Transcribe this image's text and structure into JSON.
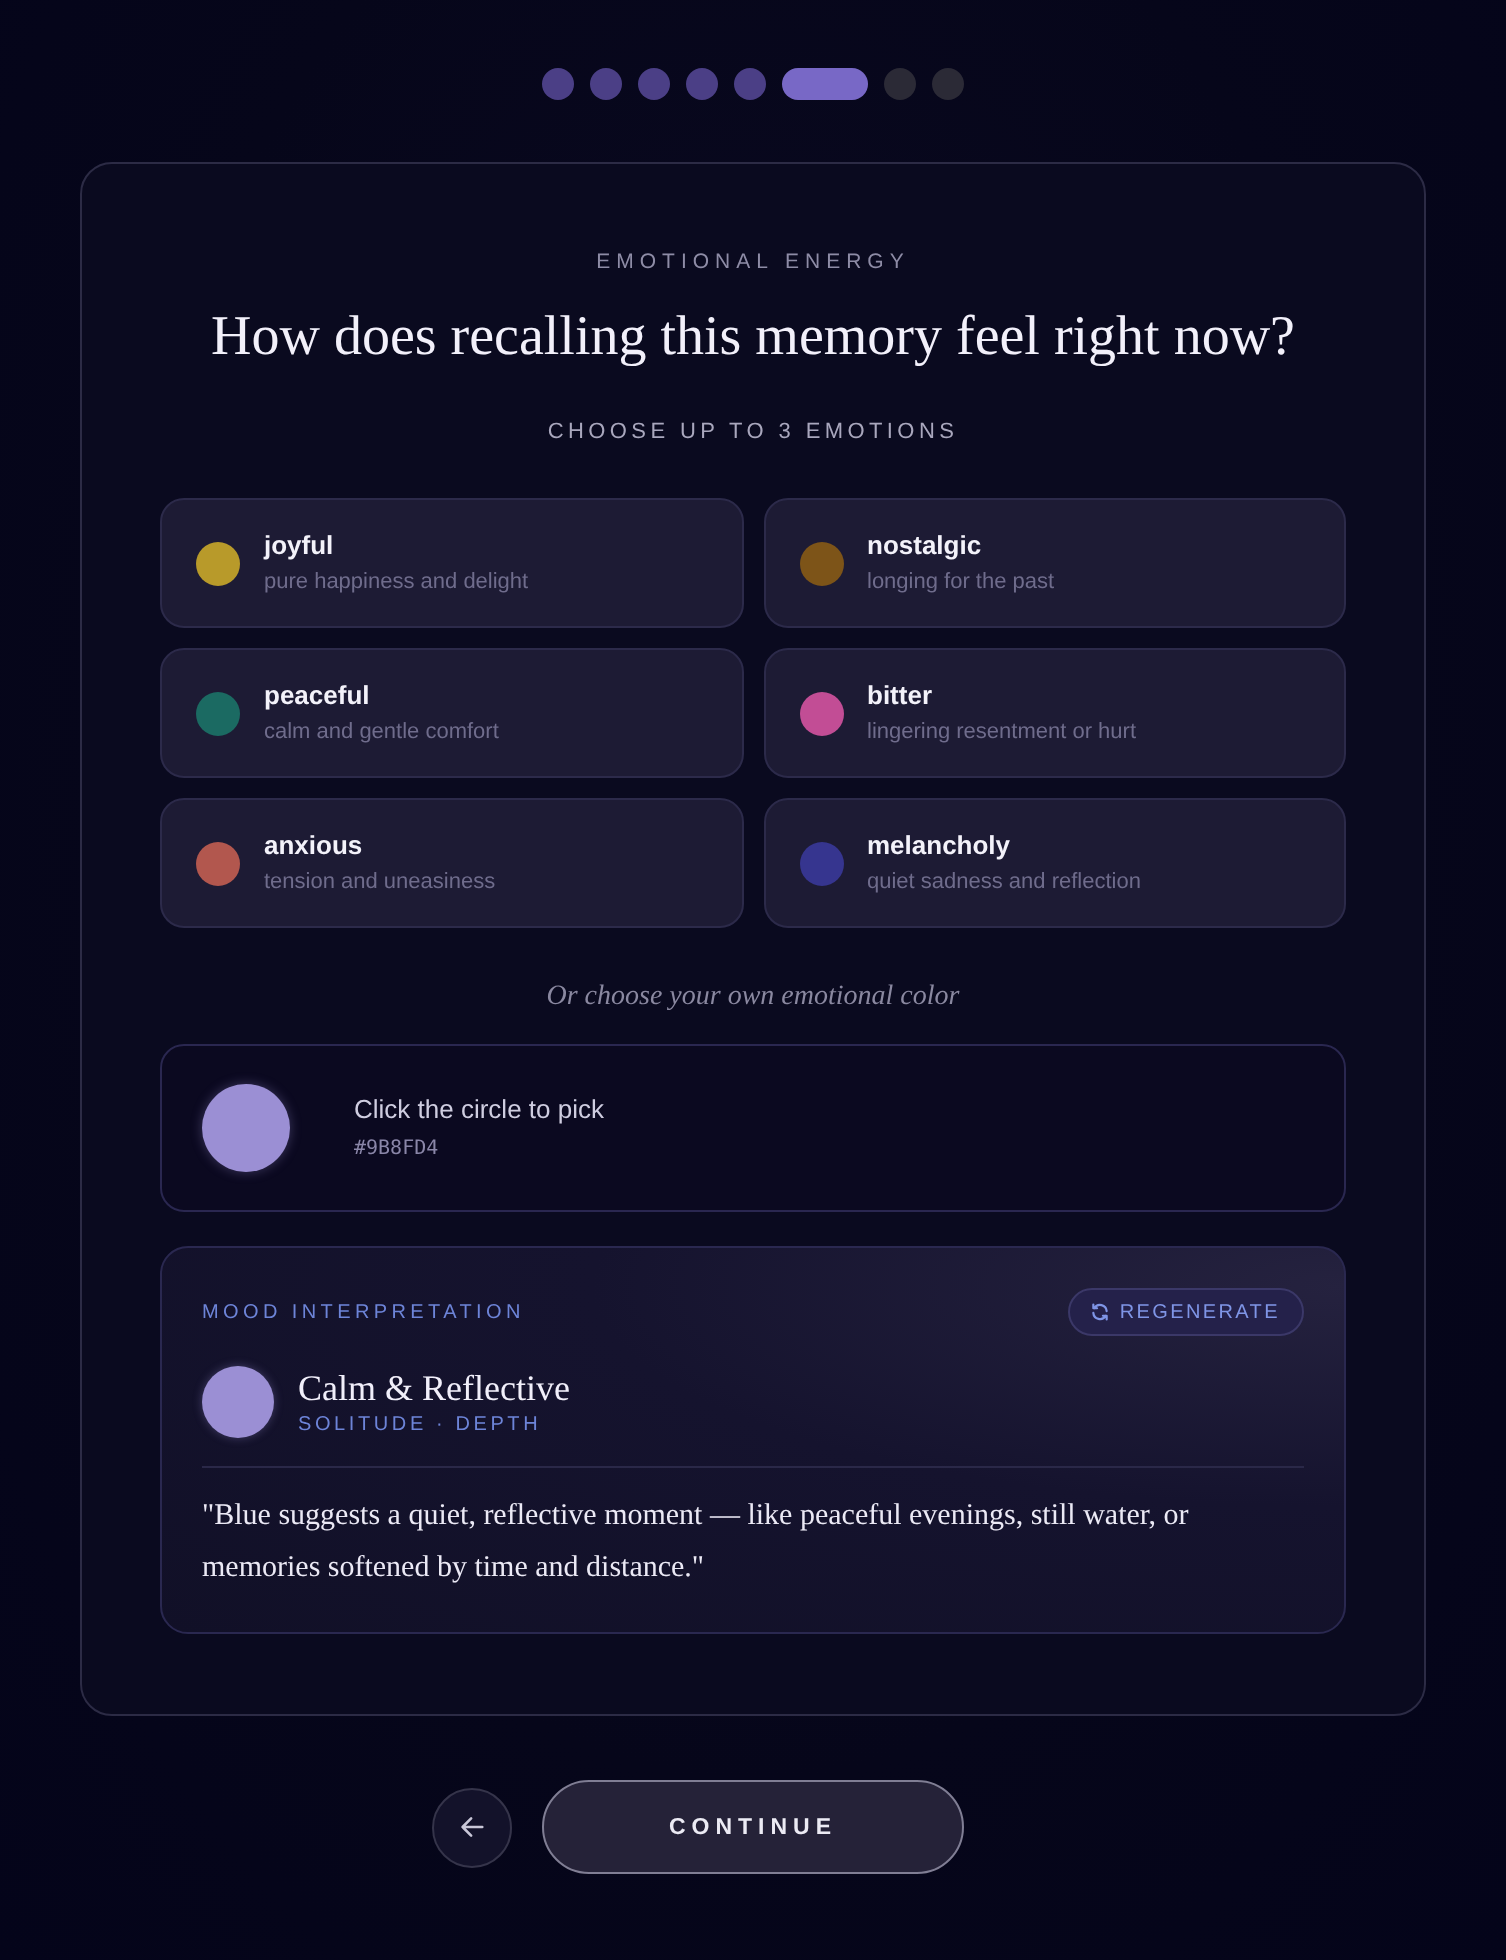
{
  "progress": [
    {
      "done": true,
      "selected": false
    },
    {
      "done": true,
      "selected": false
    },
    {
      "done": true,
      "selected": false
    },
    {
      "done": true,
      "selected": false
    },
    {
      "done": true,
      "selected": false
    },
    {
      "done": false,
      "selected": true
    },
    {
      "done": false,
      "selected": false
    },
    {
      "done": false,
      "selected": false
    }
  ],
  "card": {
    "eyebrow": "EMOTIONAL ENERGY",
    "title": "How does recalling this memory feel right now?",
    "instruction": "CHOOSE UP TO 3 EMOTIONS"
  },
  "emotions": [
    {
      "name": "joyful",
      "description": "pure happiness and delight",
      "color": "#b89a2a",
      "selected": false
    },
    {
      "name": "nostalgic",
      "description": "longing for the past",
      "color": "#7d5418",
      "selected": false
    },
    {
      "name": "peaceful",
      "description": "calm and gentle comfort",
      "color": "#1b6a62",
      "selected": false
    },
    {
      "name": "bitter",
      "description": "lingering resentment or hurt",
      "color": "#c24d95",
      "selected": false
    },
    {
      "name": "anxious",
      "description": "tension and uneasiness",
      "color": "#b2574e",
      "selected": false
    },
    {
      "name": "melancholy",
      "description": "quiet sadness and reflection",
      "color": "#36358f",
      "selected": false
    }
  ],
  "custom_color": {
    "label": "Or choose your own emotional color",
    "prompt": "Click the circle to pick",
    "hex": "#9B8FD4",
    "color": "#9b8fd4"
  },
  "mood": {
    "heading": "MOOD INTERPRETATION",
    "regenerate": "REGENERATE",
    "color": "#9b8fd4",
    "name": "Calm & Reflective",
    "tags": "SOLITUDE · DEPTH",
    "quote": "\"Blue suggests a quiet, reflective moment — like peaceful evenings, still water, or memories softened by time and distance.\""
  },
  "buttons": {
    "continue": "CONTINUE"
  }
}
